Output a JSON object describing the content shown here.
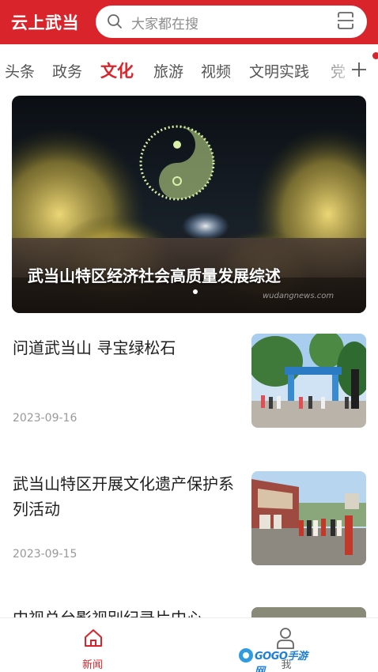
{
  "header": {
    "brand": "云上武当",
    "search_placeholder": "大家都在搜",
    "icons": {
      "search": "search-icon",
      "scan": "scan-icon"
    }
  },
  "tabs": [
    {
      "label": "头条",
      "active": false
    },
    {
      "label": "政务",
      "active": false
    },
    {
      "label": "文化",
      "active": true
    },
    {
      "label": "旅游",
      "active": false
    },
    {
      "label": "视频",
      "active": false
    },
    {
      "label": "文明实践",
      "active": false
    },
    {
      "label": "党",
      "active": false
    }
  ],
  "hero": {
    "title": "武当山特区经济社会高质量发展综述",
    "watermark": "wudangnews.com"
  },
  "news": [
    {
      "title": "问道武当山 寻宝绿松石",
      "date": "2023-09-16"
    },
    {
      "title": "武当山特区开展文化遗产保护系列活动",
      "date": "2023-09-15"
    },
    {
      "title": "中视总台影视别纪录片中心",
      "date": ""
    }
  ],
  "bottom_nav": {
    "news_label": "新闻",
    "mine_label": "我",
    "watermark": "GOGO手游网"
  },
  "colors": {
    "accent": "#d8242a",
    "muted": "#999999"
  }
}
